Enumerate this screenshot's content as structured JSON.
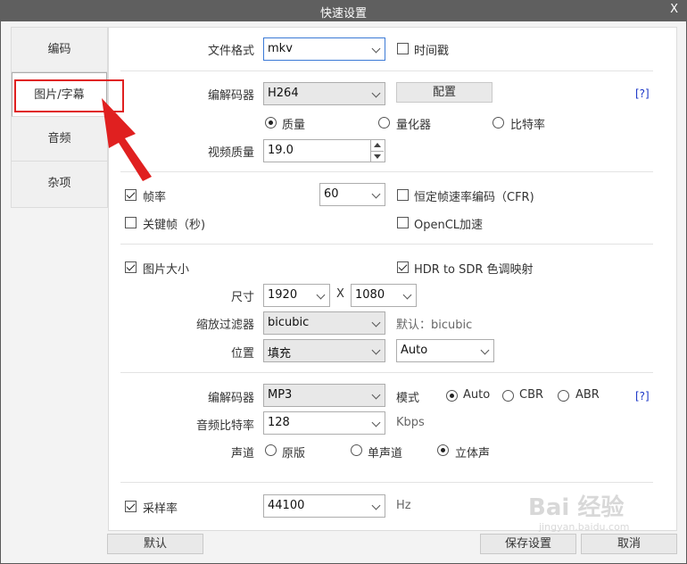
{
  "window": {
    "title": "快速设置",
    "close_label": "X"
  },
  "nav": {
    "items": [
      {
        "label": "编码"
      },
      {
        "label": "图片/字幕"
      },
      {
        "label": "音频"
      },
      {
        "label": "杂项"
      }
    ]
  },
  "video": {
    "format_label": "文件格式",
    "format_value": "mkv",
    "timestamp_label": "时间戳",
    "timestamp_checked": false,
    "codec_label": "编解码器",
    "codec_value": "H264",
    "config_button": "配置",
    "help_link": "[?]",
    "mode_options": [
      {
        "label": "质量",
        "checked": true
      },
      {
        "label": "量化器",
        "checked": false
      },
      {
        "label": "比特率",
        "checked": false
      }
    ],
    "quality_label": "视频质量",
    "quality_value": "19.0"
  },
  "framerate": {
    "fps_label": "帧率",
    "fps_checked": true,
    "fps_value": "60",
    "cfr_label": "恒定帧速率编码（CFR)",
    "cfr_checked": false,
    "keyframe_label": "关键帧（秒)",
    "keyframe_checked": false,
    "opencl_label": "OpenCL加速",
    "opencl_checked": false
  },
  "picture": {
    "size_label": "图片大小",
    "size_checked": true,
    "hdr_label": "HDR to SDR 色调映射",
    "hdr_checked": true,
    "dims_label": "尺寸",
    "width_value": "1920",
    "times": "X",
    "height_value": "1080",
    "filter_label": "缩放过滤器",
    "filter_value": "bicubic",
    "filter_default": "默认：bicubic",
    "position_label": "位置",
    "position_value": "填充",
    "position_mode": "Auto"
  },
  "audio": {
    "codec_label": "编解码器",
    "codec_value": "MP3",
    "mode_label": "模式",
    "mode_options": [
      {
        "label": "Auto",
        "checked": true
      },
      {
        "label": "CBR",
        "checked": false
      },
      {
        "label": "ABR",
        "checked": false
      }
    ],
    "help_link": "[?]",
    "bitrate_label": "音频比特率",
    "bitrate_value": "128",
    "bitrate_unit": "Kbps",
    "channel_label": "声道",
    "channel_options": [
      {
        "label": "原版",
        "checked": false
      },
      {
        "label": "单声道",
        "checked": false
      },
      {
        "label": "立体声",
        "checked": true
      }
    ],
    "samplerate_label": "采样率",
    "samplerate_checked": true,
    "samplerate_value": "44100",
    "samplerate_unit": "Hz"
  },
  "footer": {
    "default_button": "默认",
    "save_button": "保存设置",
    "cancel_button": "取消"
  },
  "annotation": {
    "highlight_color": "#e02020"
  },
  "watermark": {
    "brand": "Bai 经验",
    "url": "jingyan.baidu.com"
  }
}
